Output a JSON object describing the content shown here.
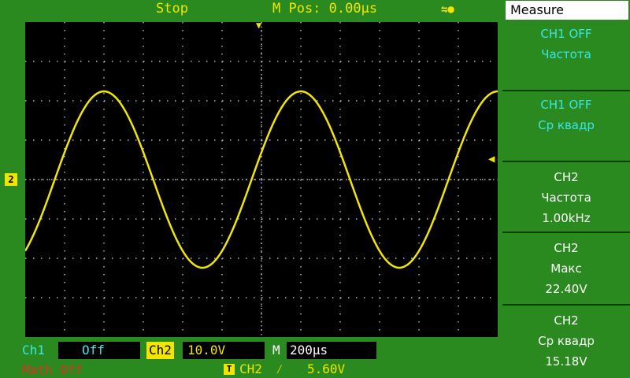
{
  "top": {
    "status": "Stop",
    "mpos": "M Pos: 0.00µs",
    "usb_icon": "usb-icon"
  },
  "markers": {
    "ch2_ground": "2",
    "trigger_pos_icon": "trigger-position-icon",
    "trigger_level_icon": "trigger-level-icon"
  },
  "bottom": {
    "ch1_label": "Ch1",
    "ch1_value": "Off",
    "ch2_label": "Ch2",
    "ch2_value": "10.0V",
    "m_label": "M",
    "m_value": "200µs",
    "math_label": "Math Off",
    "trig_badge": "T",
    "trig_source": "CH2",
    "trig_slope": "⁄",
    "trig_level": "5.60V"
  },
  "menu": {
    "title": "Measure",
    "items": [
      {
        "line1": "CH1  OFF",
        "line2": "Частота",
        "line3": ""
      },
      {
        "line1": "CH1  OFF",
        "line2": "Ср  квадр",
        "line3": ""
      },
      {
        "line1": "CH2",
        "line2": "Частота",
        "line3": "1.00kHz"
      },
      {
        "line1": "CH2",
        "line2": "Макс",
        "line3": "22.40V"
      },
      {
        "line1": "CH2",
        "line2": "Ср  квадр",
        "line3": "15.18V"
      }
    ]
  },
  "colors": {
    "trace": "#f2e600",
    "background": "#2a8a1f",
    "screen": "#000000",
    "cyan": "#39e6e6",
    "math": "#e0302a"
  },
  "waveform": {
    "channel": "CH2",
    "volts_per_div": 10.0,
    "time_per_div_us": 200,
    "frequency_khz": 1.0,
    "peak_v": 22.4,
    "rms_v": 15.18
  }
}
